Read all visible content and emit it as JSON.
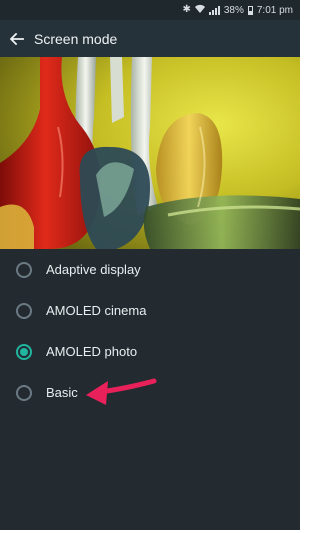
{
  "status_bar": {
    "icons": [
      "bluetooth-icon",
      "wifi-icon",
      "signal-icon"
    ],
    "battery": "38%",
    "time": "7:01 pm"
  },
  "app_bar": {
    "back_icon": "back-arrow-icon",
    "title": "Screen mode"
  },
  "options": [
    {
      "label": "Adaptive display",
      "selected": false
    },
    {
      "label": "AMOLED cinema",
      "selected": false
    },
    {
      "label": "AMOLED photo",
      "selected": true
    },
    {
      "label": "Basic",
      "selected": false
    }
  ],
  "colors": {
    "accent": "#1fb6a1",
    "annotation_arrow": "#e8215a"
  }
}
